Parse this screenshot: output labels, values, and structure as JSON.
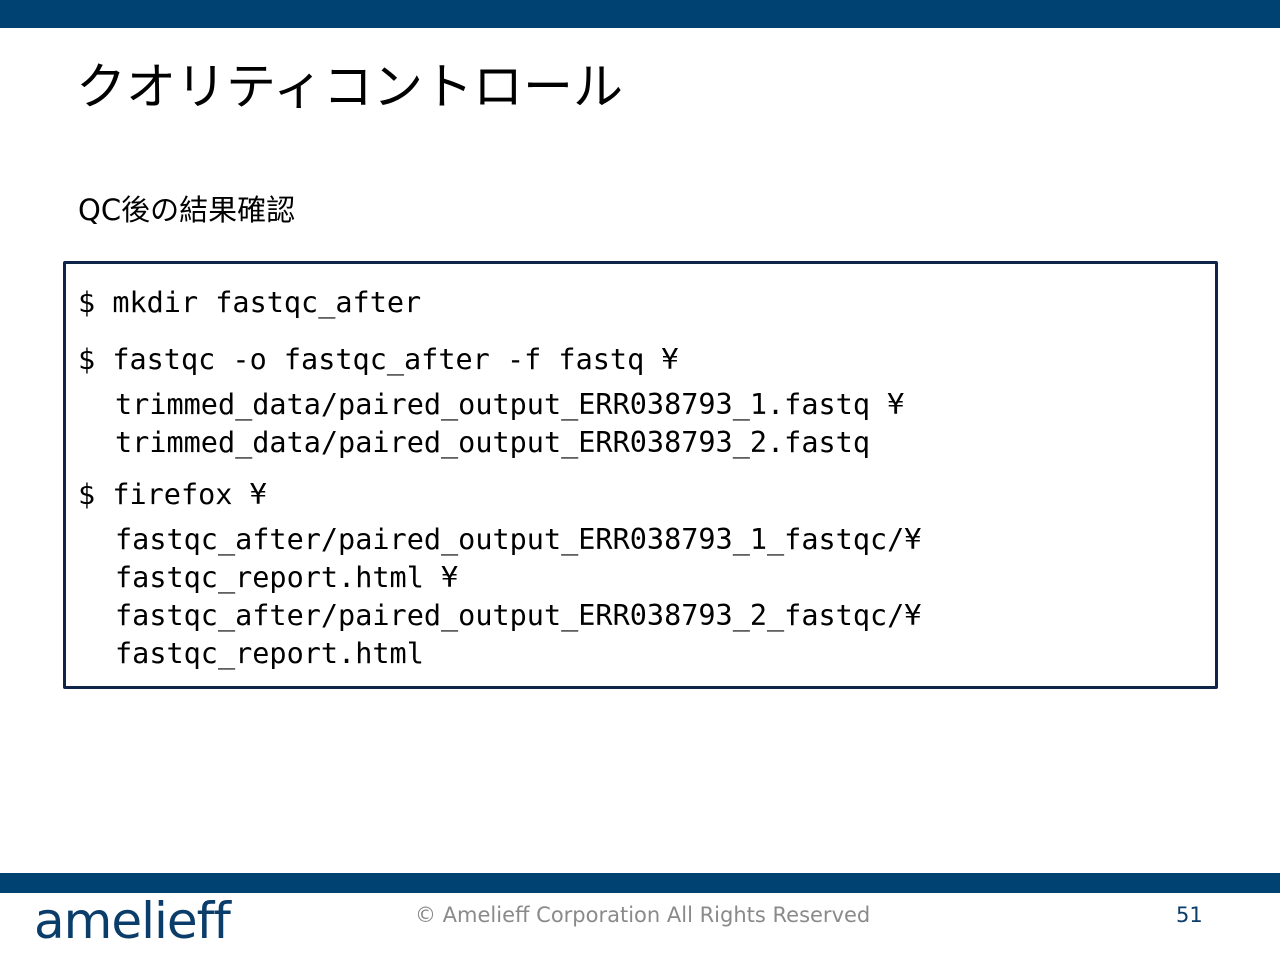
{
  "slide": {
    "title": "クオリティコントロール",
    "subtitle": "QC後の結果確認"
  },
  "code": {
    "cmd1": "$ mkdir fastqc_after",
    "cmd2_line1": "$ fastqc -o fastqc_after -f fastq ¥",
    "cmd2_line2": "trimmed_data/paired_output_ERR038793_1.fastq ¥",
    "cmd2_line3": "trimmed_data/paired_output_ERR038793_2.fastq",
    "cmd3_line1": "$ firefox ¥",
    "cmd3_line2": "fastqc_after/paired_output_ERR038793_1_fastqc/¥",
    "cmd3_line3": "fastqc_report.html ¥",
    "cmd3_line4": "fastqc_after/paired_output_ERR038793_2_fastqc/¥",
    "cmd3_line5": "fastqc_report.html"
  },
  "footer": {
    "logo": "amelieff",
    "copyright": "© Amelieff Corporation All Rights Reserved",
    "page_number": "51"
  },
  "colors": {
    "bar": "#004272",
    "code_border": "#0f2449",
    "logo": "#0b3d6b",
    "copyright": "#8a8a8a"
  }
}
